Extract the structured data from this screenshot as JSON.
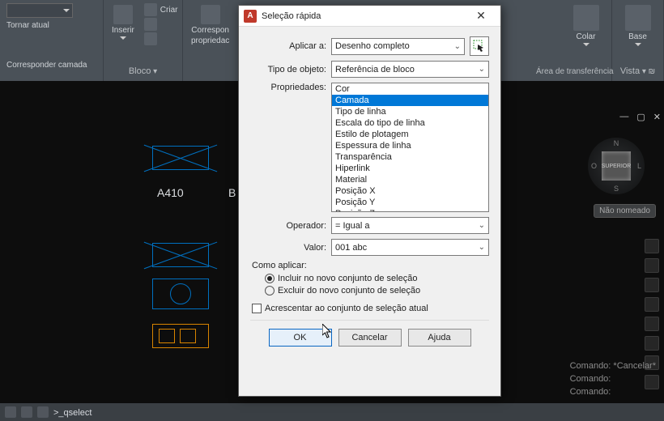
{
  "ribbon": {
    "layers": {
      "tornar_atual": "Tornar atual",
      "corresponder": "Corresponder camada"
    },
    "bloco": {
      "criar": "Criar",
      "inserir": "Inserir",
      "label": "Bloco"
    },
    "props": {
      "corresponder": "Correspon",
      "propriedades": "propriedac"
    },
    "colar": "Colar",
    "base": "Base",
    "clipboard_label": "Área de transferência",
    "vista_label": "Vista"
  },
  "dialog": {
    "title": "Seleção rápida",
    "aplicar_a": {
      "label": "Aplicar a:",
      "value": "Desenho completo"
    },
    "tipo_objeto": {
      "label": "Tipo de objeto:",
      "value": "Referência de bloco"
    },
    "propriedades": {
      "label": "Propriedades:",
      "items": [
        "Cor",
        "Camada",
        "Tipo de linha",
        "Escala do tipo de linha",
        "Estilo de plotagem",
        "Espessura de linha",
        "Transparência",
        "Hiperlink",
        "Material",
        "Posição X",
        "Posição Y",
        "Posição Z"
      ],
      "selected_index": 1
    },
    "operador": {
      "label": "Operador:",
      "value": "= Igual a"
    },
    "valor": {
      "label": "Valor:",
      "value": "001 abc"
    },
    "como_aplicar": "Como aplicar:",
    "radio_incluir": "Incluir no novo conjunto de seleção",
    "radio_excluir": "Excluir do novo conjunto de seleção",
    "check_acrescentar": "Acrescentar ao conjunto de seleção atual",
    "buttons": {
      "ok": "OK",
      "cancel": "Cancelar",
      "help": "Ajuda"
    }
  },
  "canvas": {
    "text1": "A410",
    "text2": "B"
  },
  "viewcube": {
    "face": "SUPERIOR",
    "n": "N",
    "s": "S",
    "o": "O",
    "l": "L"
  },
  "tag": "Não nomeado",
  "cmdlog": {
    "l1": "Comando: *Cancelar*",
    "l2": "Comando:",
    "l3": "Comando:"
  },
  "cmdline": {
    "prompt": ">_",
    "value": "qselect"
  }
}
